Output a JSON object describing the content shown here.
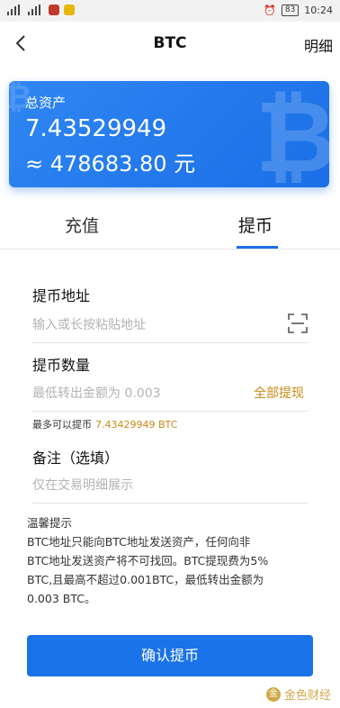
{
  "status_bar": {
    "time": "10:24",
    "battery": "83"
  },
  "nav": {
    "title": "BTC",
    "detail_label": "明细"
  },
  "asset": {
    "label": "总资产",
    "amount": "7.43529949",
    "cny": "≈ 478683.80 元"
  },
  "tabs": {
    "recharge": "充值",
    "withdraw": "提币",
    "active": "withdraw"
  },
  "form": {
    "address_label": "提币地址",
    "address_placeholder": "输入或长按粘贴地址",
    "amount_label": "提币数量",
    "amount_placeholder": "最低转出金额为 0.003",
    "all_button": "全部提现",
    "max_label": "最多可以提币",
    "max_value": "7.43429949 BTC",
    "memo_label": "备注（选填）",
    "memo_placeholder": "仅在交易明细展示"
  },
  "tips": {
    "title": "温馨提示",
    "line1": "BTC地址只能向BTC地址发送资产，任何向非",
    "line2": "BTC地址发送资产将不可找回。BTC提现费为5%",
    "line3": "BTC,且最高不超过0.001BTC，最低转出金额为",
    "line4": "0.003 BTC。"
  },
  "confirm_button": "确认提币",
  "brand": {
    "name": "金色财经",
    "logo_text": "金"
  },
  "colors": {
    "primary": "#1a73e8",
    "accent": "#c88a16"
  }
}
